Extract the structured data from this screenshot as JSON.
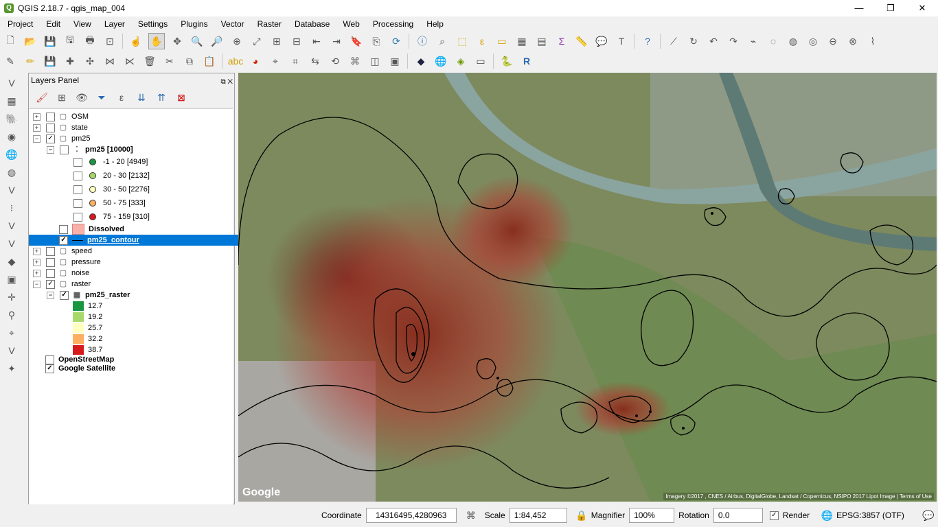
{
  "window": {
    "title": "QGIS 2.18.7 - qgis_map_004",
    "minimize": "—",
    "restore": "❐",
    "close": "✕"
  },
  "menu": [
    "Project",
    "Edit",
    "View",
    "Layer",
    "Settings",
    "Plugins",
    "Vector",
    "Raster",
    "Database",
    "Web",
    "Processing",
    "Help"
  ],
  "layers_panel": {
    "title": "Layers Panel",
    "items": [
      {
        "label": "OSM",
        "checked": false
      },
      {
        "label": "state",
        "checked": false
      },
      {
        "label": "pm25",
        "checked": true
      },
      {
        "label": "pm25 [10000]",
        "checked": false
      },
      {
        "label": "-1 - 20  [4949]",
        "color": "#1a9641"
      },
      {
        "label": "20 - 30  [2132]",
        "color": "#a6d96a"
      },
      {
        "label": "30 - 50  [2276]",
        "color": "#ffffbf"
      },
      {
        "label": "50 - 75  [333]",
        "color": "#fdae61"
      },
      {
        "label": "75 - 159  [310]",
        "color": "#d7191c"
      },
      {
        "label": "Dissolved",
        "checked": false,
        "color": "#f8b0a8"
      },
      {
        "label": "pm25_contour",
        "checked": true
      },
      {
        "label": "speed",
        "checked": false
      },
      {
        "label": "pressure",
        "checked": false
      },
      {
        "label": "noise",
        "checked": false
      },
      {
        "label": "raster",
        "checked": true
      },
      {
        "label": "pm25_raster",
        "checked": true
      },
      {
        "label": "12.7",
        "color": "#1a9641"
      },
      {
        "label": "19.2",
        "color": "#a6d96a"
      },
      {
        "label": "25.7",
        "color": "#ffffbf"
      },
      {
        "label": "32.2",
        "color": "#fdae61"
      },
      {
        "label": "38.7",
        "color": "#d7191c"
      },
      {
        "label": "OpenStreetMap",
        "checked": false
      },
      {
        "label": "Google Satellite",
        "checked": true
      }
    ]
  },
  "map": {
    "attribution": "Imagery ©2017 , CNES / Airbus, DigitalGlobe, Landsat / Copernicus, NSIPO 2017 Lipot Image  |  Terms of Use",
    "logo": "Google"
  },
  "status": {
    "coordinate_label": "Coordinate",
    "coordinate_value": "14316495,4280963",
    "scale_label": "Scale",
    "scale_value": "1:84,452",
    "magnifier_label": "Magnifier",
    "magnifier_value": "100%",
    "rotation_label": "Rotation",
    "rotation_value": "0.0",
    "render_label": "Render",
    "crs": "EPSG:3857 (OTF)"
  }
}
